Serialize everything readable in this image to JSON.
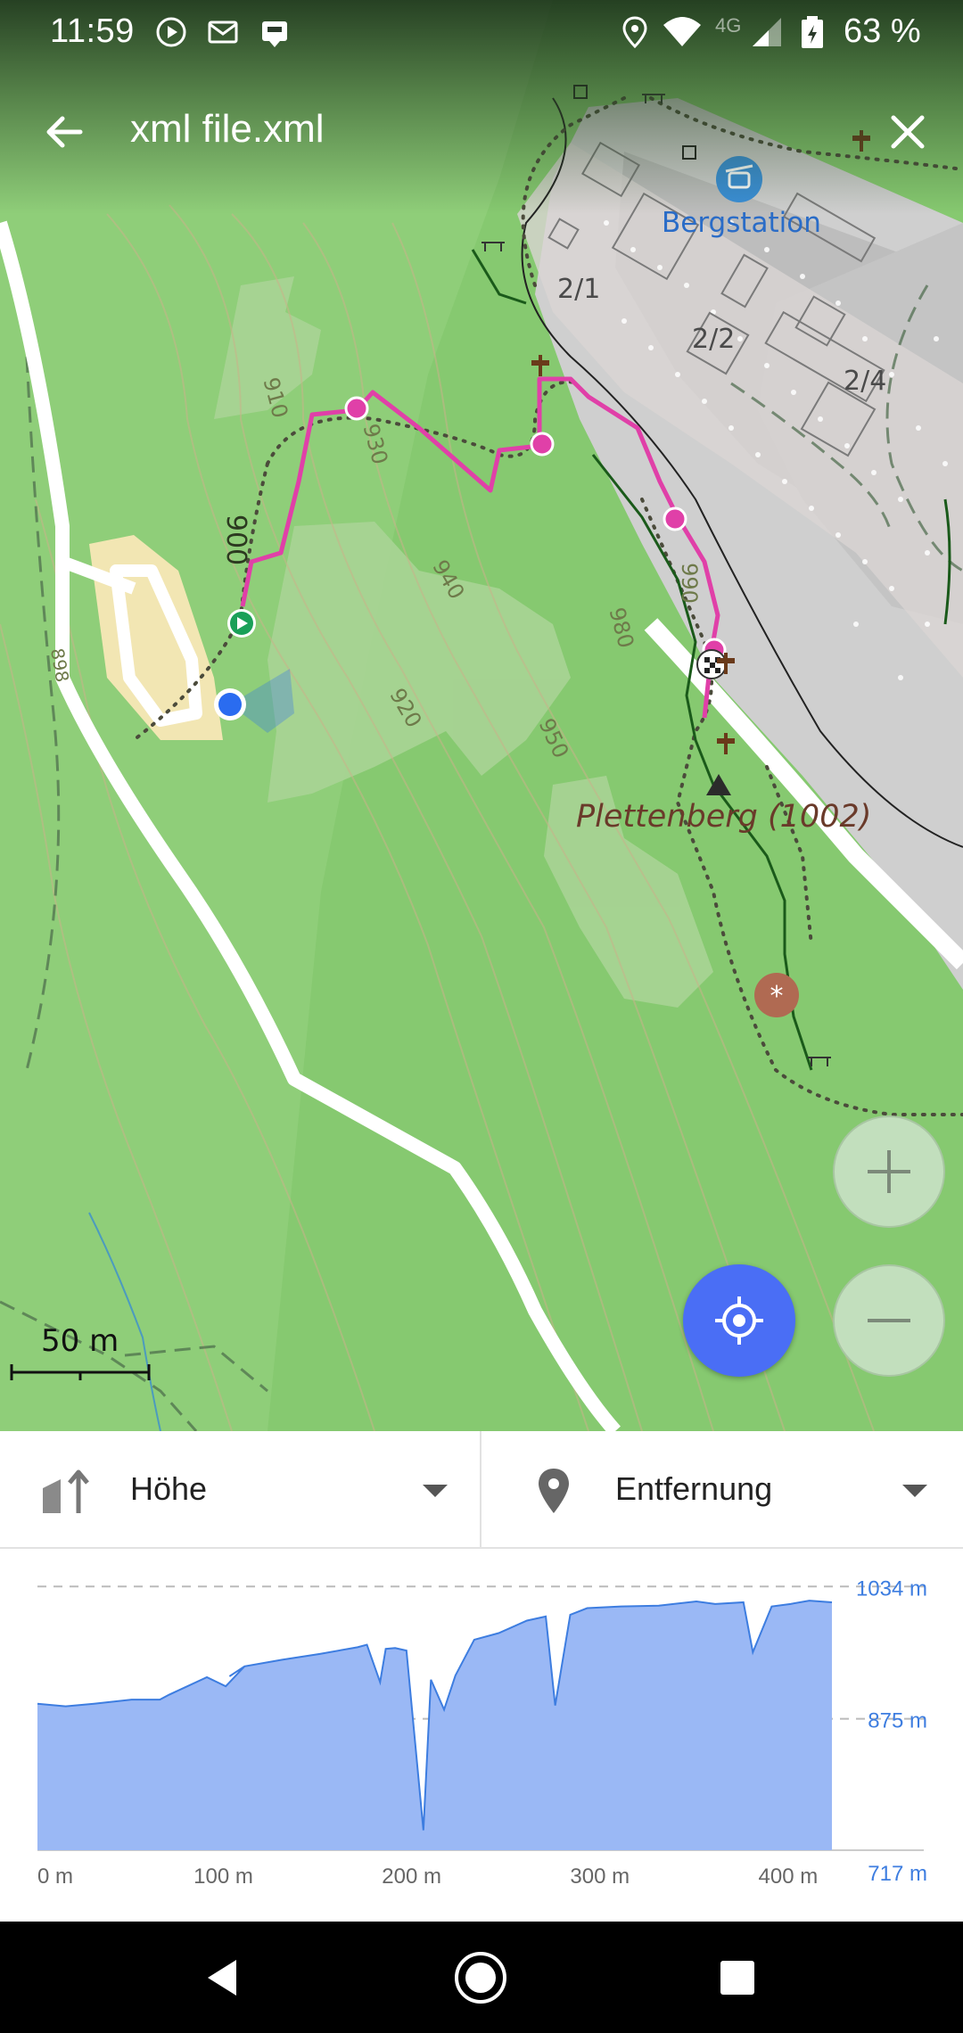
{
  "status_bar": {
    "time": "11:59",
    "network": "4G",
    "battery": "63 %",
    "icons": [
      "play-circle-icon",
      "mail-icon",
      "download-bag-icon",
      "location-pin-icon",
      "wifi-icon",
      "signal-icon",
      "battery-icon"
    ]
  },
  "toolbar": {
    "title": "xml file.xml",
    "back_icon": "arrow-left-icon",
    "close_icon": "close-icon"
  },
  "map": {
    "labels": {
      "bergstation": "Bergstation",
      "block_21": "2/1",
      "block_22": "2/2",
      "block_24": "2/4",
      "peak": "Plettenberg (1002)"
    },
    "contours": [
      "910",
      "930",
      "900",
      "940",
      "980",
      "990",
      "920",
      "950",
      "898"
    ],
    "scale": "50 m",
    "colors": {
      "track": "#e040a8",
      "location": "#2a6cf0",
      "locate_button": "#4a6ef5"
    }
  },
  "controls": {
    "zoom_in_icon": "plus-icon",
    "zoom_out_icon": "minus-icon",
    "locate_icon": "my-location-icon"
  },
  "selectors": {
    "y_axis": {
      "label": "Höhe",
      "icon": "elevation-icon"
    },
    "x_axis": {
      "label": "Entfernung",
      "icon": "location-pin-icon"
    }
  },
  "chart_data": {
    "type": "area",
    "xlabel": "",
    "ylabel": "",
    "xlim": [
      0,
      422
    ],
    "ylim": [
      717,
      1060
    ],
    "x_ticks": [
      "0 m",
      "100 m",
      "200 m",
      "300 m",
      "400 m"
    ],
    "x_tick_values": [
      0,
      100,
      200,
      300,
      400
    ],
    "y_ticks": [
      "1034 m",
      "875 m",
      "717 m"
    ],
    "y_tick_values": [
      1034,
      875,
      717
    ],
    "grid": true,
    "color": "#9ab8f5",
    "line_color": "#3d7de0",
    "series": [
      {
        "x": [
          0,
          15,
          30,
          50,
          65,
          70,
          90,
          100,
          110,
          102,
          110,
          130,
          150,
          170,
          175,
          182,
          185,
          190,
          196,
          205,
          209,
          216,
          222,
          232,
          245,
          260,
          270,
          275,
          283,
          292,
          310,
          330,
          350,
          360,
          375,
          380,
          390,
          400,
          410,
          422
        ],
        "y": [
          893,
          890,
          893,
          898,
          898,
          904,
          925,
          914,
          938,
          926,
          938,
          946,
          953,
          961,
          964,
          919,
          959,
          960,
          957,
          741,
          922,
          886,
          927,
          970,
          978,
          993,
          998,
          891,
          1000,
          1008,
          1010,
          1011,
          1016,
          1013,
          1015,
          955,
          1010,
          1013,
          1017,
          1015
        ]
      }
    ]
  }
}
